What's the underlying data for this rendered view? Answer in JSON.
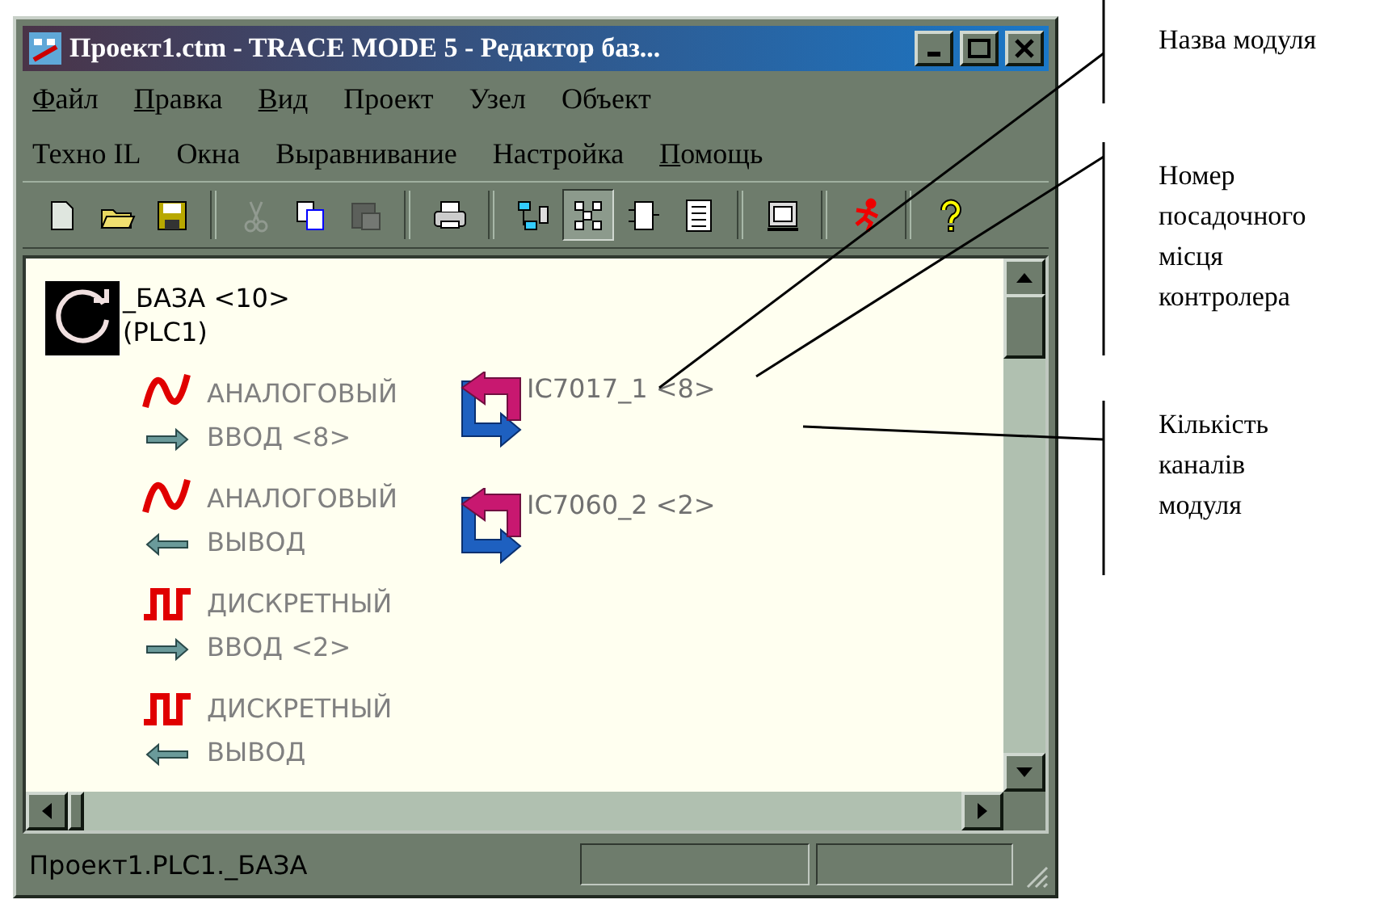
{
  "window": {
    "title": "Проект1.ctm - TRACE MODE 5 - Редактор баз..."
  },
  "menu_rows": [
    [
      {
        "label": "Файл",
        "underlined_first": true
      },
      {
        "label": "Правка",
        "underlined_first": true
      },
      {
        "label": "Вид",
        "underlined_first": true
      },
      {
        "label": "Проект",
        "underlined_first": false
      },
      {
        "label": "Узел",
        "underlined_first": false
      },
      {
        "label": "Объект",
        "underlined_first": false
      }
    ],
    [
      {
        "label": "Техно IL",
        "underlined_first": false
      },
      {
        "label": "Окна",
        "underlined_first": false
      },
      {
        "label": "Выравнивание",
        "underlined_first": false
      },
      {
        "label": "Настройка",
        "underlined_first": false
      },
      {
        "label": "Помощь",
        "underlined_first": true
      }
    ]
  ],
  "toolbar": [
    {
      "kind": "button",
      "pressed": false,
      "disabled": false
    },
    {
      "kind": "button",
      "pressed": false,
      "disabled": false
    },
    {
      "kind": "button",
      "pressed": false,
      "disabled": false
    },
    {
      "kind": "separator"
    },
    {
      "kind": "button",
      "pressed": false,
      "disabled": true
    },
    {
      "kind": "button",
      "pressed": false,
      "disabled": false
    },
    {
      "kind": "button",
      "pressed": false,
      "disabled": true
    },
    {
      "kind": "separator"
    },
    {
      "kind": "button",
      "pressed": false,
      "disabled": false
    },
    {
      "kind": "separator"
    },
    {
      "kind": "button",
      "pressed": false,
      "disabled": false
    },
    {
      "kind": "button",
      "pressed": true,
      "disabled": false
    },
    {
      "kind": "button",
      "pressed": false,
      "disabled": false
    },
    {
      "kind": "button",
      "pressed": false,
      "disabled": false
    },
    {
      "kind": "separator"
    },
    {
      "kind": "button",
      "pressed": false,
      "disabled": false
    },
    {
      "kind": "separator"
    },
    {
      "kind": "button",
      "pressed": false,
      "disabled": false
    },
    {
      "kind": "separator"
    },
    {
      "kind": "button",
      "pressed": false,
      "disabled": false
    }
  ],
  "root": {
    "label": "_БАЗА <10>",
    "sublabel": "(PLC1)"
  },
  "channels": [
    {
      "kind": "analog_in",
      "lines": [
        "АНАЛОГОВЫЙ",
        "ВВОД <8>"
      ]
    },
    {
      "kind": "analog_out",
      "lines": [
        "АНАЛОГОВЫЙ",
        "ВЫВОД"
      ]
    },
    {
      "kind": "discrete_in",
      "lines": [
        "ДИСКРЕТНЫЙ",
        "ВВОД <2>"
      ]
    },
    {
      "kind": "discrete_out",
      "lines": [
        "ДИСКРЕТНЫЙ",
        "ВЫВОД"
      ]
    }
  ],
  "modules": [
    {
      "label": "IC7017_1 <8>"
    },
    {
      "label": "IC7060_2 <2>"
    }
  ],
  "status_bar": {
    "path": "Проект1.PLC1._БАЗА"
  },
  "annotations": [
    {
      "lines": [
        "Назва модуля"
      ]
    },
    {
      "lines": [
        "Номер",
        "посадочного",
        "місця",
        "контролера"
      ]
    },
    {
      "lines": [
        "Кількість",
        "каналів",
        "модуля"
      ]
    }
  ]
}
